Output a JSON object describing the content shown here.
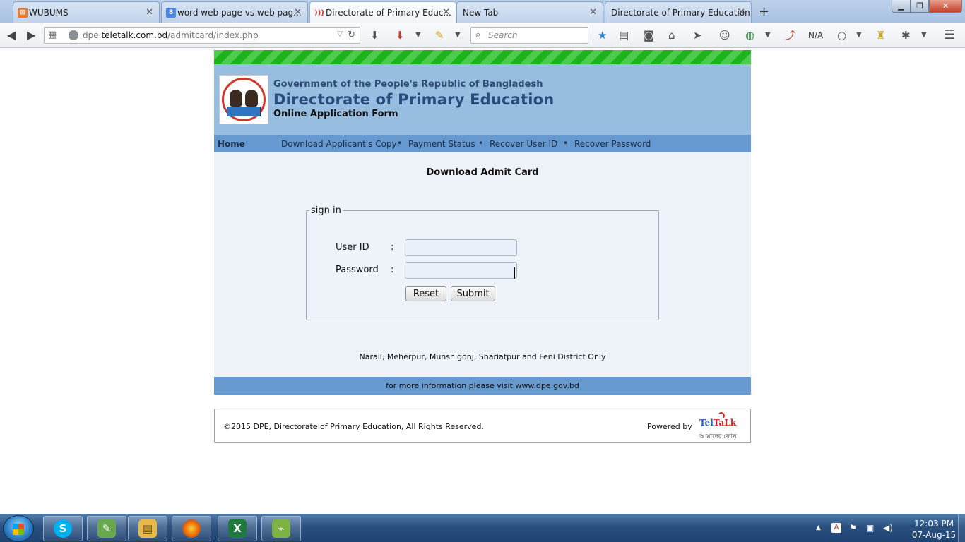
{
  "browser": {
    "tabs": [
      {
        "title": "WUBUMS",
        "favicon_color": "#f07a2b",
        "favicon_glyph": "⊠"
      },
      {
        "title": "word web page vs web pag...",
        "favicon_color": "#4a88e8",
        "favicon_glyph": "8"
      },
      {
        "title": "Directorate of Primary Educ...",
        "favicon_color": "#d93a2b",
        "favicon_glyph": ")))"
      },
      {
        "title": "New Tab",
        "favicon_color": "",
        "favicon_glyph": ""
      },
      {
        "title": "Directorate of Primary Education",
        "favicon_color": "",
        "favicon_glyph": ""
      }
    ],
    "active_tab": 2,
    "url_prefix": "dpe.",
    "url_host": "teletalk.com.bd",
    "url_path": "/admitcard/index.php",
    "search_placeholder": "Search",
    "toolbar_na_label": "N/A"
  },
  "page": {
    "gov_line": "Government of the People's Republic of Bangladesh",
    "org_title": "Directorate of Primary Education",
    "form_subtitle": "Online Application Form",
    "nav": {
      "home": "Home",
      "items": [
        "Download Applicant's Copy",
        "Payment Status",
        "Recover User ID",
        "Recover Password"
      ],
      "separator": "•"
    },
    "content_title": "Download Admit Card",
    "signin": {
      "legend": "sign in",
      "user_id_label": "User ID",
      "password_label": "Password",
      "colon": ":",
      "user_id_value": "",
      "password_value": "",
      "reset_label": "Reset",
      "submit_label": "Submit"
    },
    "districts_note": "Narail, Meherpur, Munshigonj, Shariatpur and Feni District Only",
    "info_line": "for more information please visit www.dpe.gov.bd",
    "footer": {
      "copyright": "©2015 DPE, Directorate of Primary Education, All Rights Reserved.",
      "powered_by": "Powered by",
      "logo_tel": "Tel",
      "logo_talk": "TaLk",
      "logo_tagline": "আমাদের ফোন"
    },
    "colors": {
      "stripe_green": "#1db31d",
      "header_blue": "#97bde1",
      "menu_blue": "#6599cf",
      "title_blue": "#2a4b7c"
    }
  },
  "taskbar": {
    "pinned_apps": [
      {
        "name": "skype",
        "glyph": "S",
        "color": "#00aff0"
      },
      {
        "name": "pen-tool",
        "glyph": "✎",
        "color": "#6aa84f"
      },
      {
        "name": "file-explorer",
        "glyph": "▤",
        "color": "#e7b94a"
      },
      {
        "name": "firefox",
        "glyph": "●",
        "color": "#e66000"
      },
      {
        "name": "excel",
        "glyph": "X",
        "color": "#1f7a3e"
      },
      {
        "name": "graph-app",
        "glyph": "⌁",
        "color": "#7cb342"
      }
    ],
    "clock_time": "12:03 PM",
    "clock_date": "07-Aug-15"
  }
}
